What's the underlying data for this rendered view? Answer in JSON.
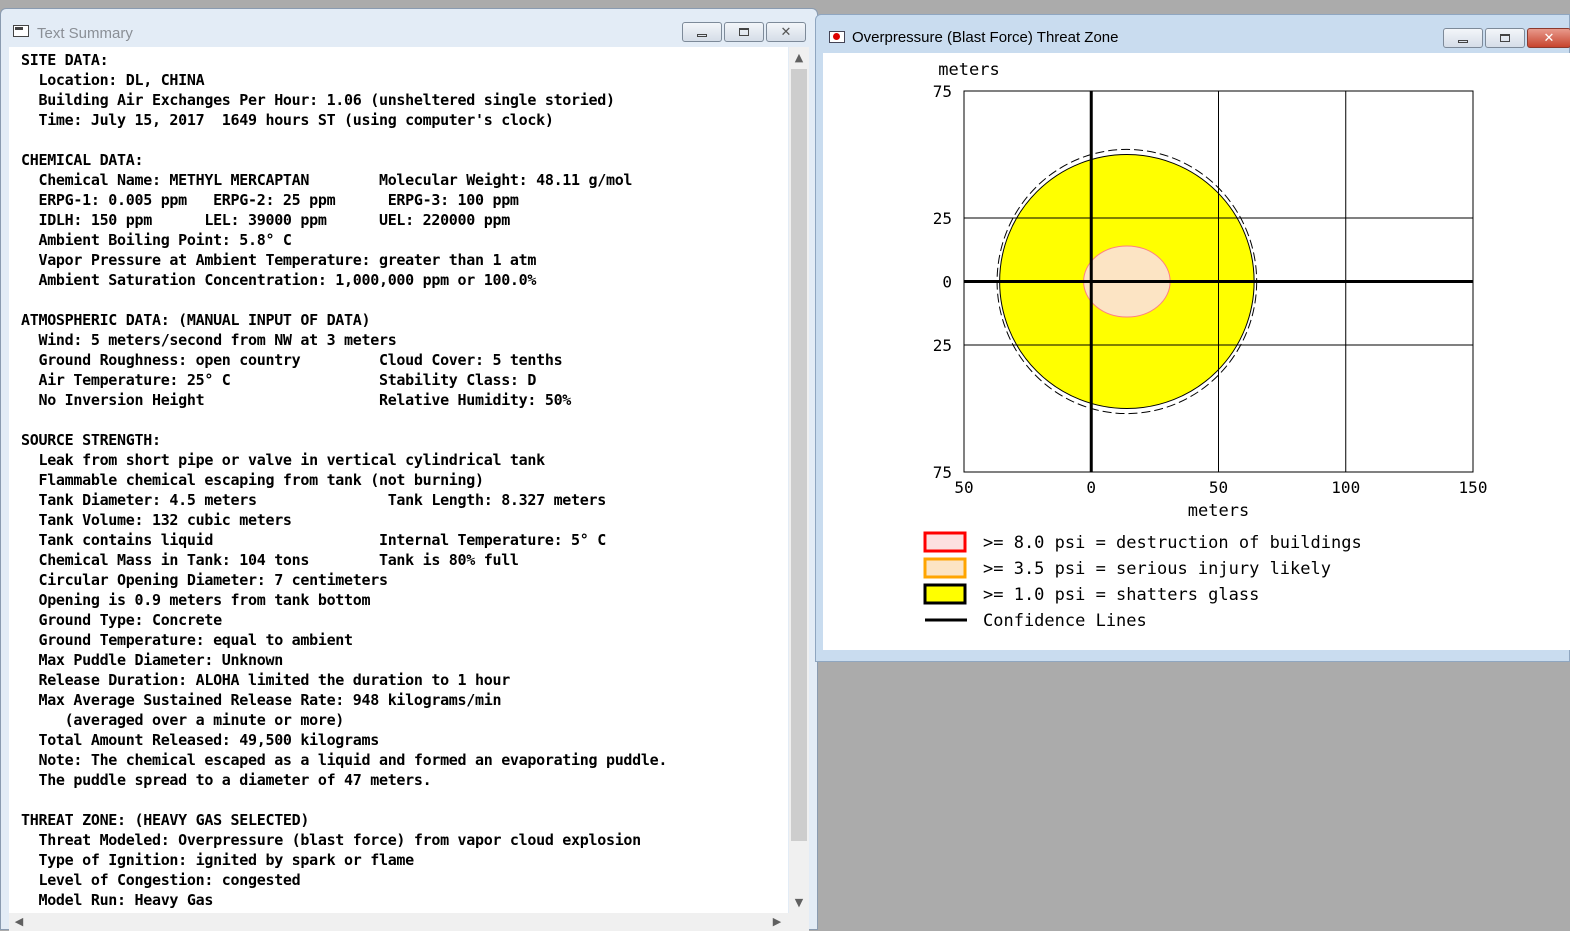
{
  "text_summary": {
    "title": "Text Summary",
    "lines": [
      "SITE DATA:",
      "  Location: DL, CHINA",
      "  Building Air Exchanges Per Hour: 1.06 (unsheltered single storied)",
      "  Time: July 15, 2017  1649 hours ST (using computer's clock)",
      "",
      "CHEMICAL DATA:",
      "  Chemical Name: METHYL MERCAPTAN        Molecular Weight: 48.11 g/mol",
      "  ERPG-1: 0.005 ppm   ERPG-2: 25 ppm      ERPG-3: 100 ppm",
      "  IDLH: 150 ppm      LEL: 39000 ppm      UEL: 220000 ppm",
      "  Ambient Boiling Point: 5.8° C",
      "  Vapor Pressure at Ambient Temperature: greater than 1 atm",
      "  Ambient Saturation Concentration: 1,000,000 ppm or 100.0%",
      "",
      "ATMOSPHERIC DATA: (MANUAL INPUT OF DATA)",
      "  Wind: 5 meters/second from NW at 3 meters",
      "  Ground Roughness: open country         Cloud Cover: 5 tenths",
      "  Air Temperature: 25° C                 Stability Class: D",
      "  No Inversion Height                    Relative Humidity: 50%",
      "",
      "SOURCE STRENGTH:",
      "  Leak from short pipe or valve in vertical cylindrical tank",
      "  Flammable chemical escaping from tank (not burning)",
      "  Tank Diameter: 4.5 meters               Tank Length: 8.327 meters",
      "  Tank Volume: 132 cubic meters",
      "  Tank contains liquid                   Internal Temperature: 5° C",
      "  Chemical Mass in Tank: 104 tons        Tank is 80% full",
      "  Circular Opening Diameter: 7 centimeters",
      "  Opening is 0.9 meters from tank bottom",
      "  Ground Type: Concrete",
      "  Ground Temperature: equal to ambient",
      "  Max Puddle Diameter: Unknown",
      "  Release Duration: ALOHA limited the duration to 1 hour",
      "  Max Average Sustained Release Rate: 948 kilograms/min",
      "     (averaged over a minute or more)",
      "  Total Amount Released: 49,500 kilograms",
      "  Note: The chemical escaped as a liquid and formed an evaporating puddle.",
      "  The puddle spread to a diameter of 47 meters.",
      "",
      "THREAT ZONE: (HEAVY GAS SELECTED)",
      "  Threat Modeled: Overpressure (blast force) from vapor cloud explosion",
      "  Type of Ignition: ignited by spark or flame",
      "  Level of Congestion: congested",
      "  Model Run: Heavy Gas"
    ]
  },
  "threat_zone": {
    "title": "Overpressure (Blast Force) Threat Zone",
    "chart_data": {
      "type": "area",
      "xlabel": "meters",
      "ylabel": "meters",
      "x_ticks": [
        "50",
        "0",
        "50",
        "100",
        "150"
      ],
      "x_tick_values": [
        -50,
        0,
        50,
        100,
        150
      ],
      "y_ticks": [
        "75",
        "25",
        "0",
        "25",
        "75"
      ],
      "y_tick_values": [
        75,
        25,
        0,
        -25,
        -75
      ],
      "xlim": [
        -50,
        150
      ],
      "ylim": [
        -75,
        75
      ],
      "grid": true,
      "zones": [
        {
          "label": ">= 8.0 psi = destruction of buildings",
          "color": "#ff0000",
          "present": false
        },
        {
          "label": ">= 3.5 psi = serious injury likely",
          "color": "#ffa500",
          "ellipse": {
            "cx": 14,
            "cy": 0,
            "rx": 17,
            "ry": 14
          }
        },
        {
          "label": ">= 1.0 psi = shatters glass",
          "color": "#ffff00",
          "ellipse": {
            "cx": 14,
            "cy": 0,
            "rx": 50,
            "ry": 50
          }
        }
      ],
      "confidence_lines": {
        "label": "Confidence Lines",
        "cx": 14,
        "cy": 0,
        "rx": 51,
        "ry": 52
      },
      "legend_position": "bottom"
    }
  }
}
